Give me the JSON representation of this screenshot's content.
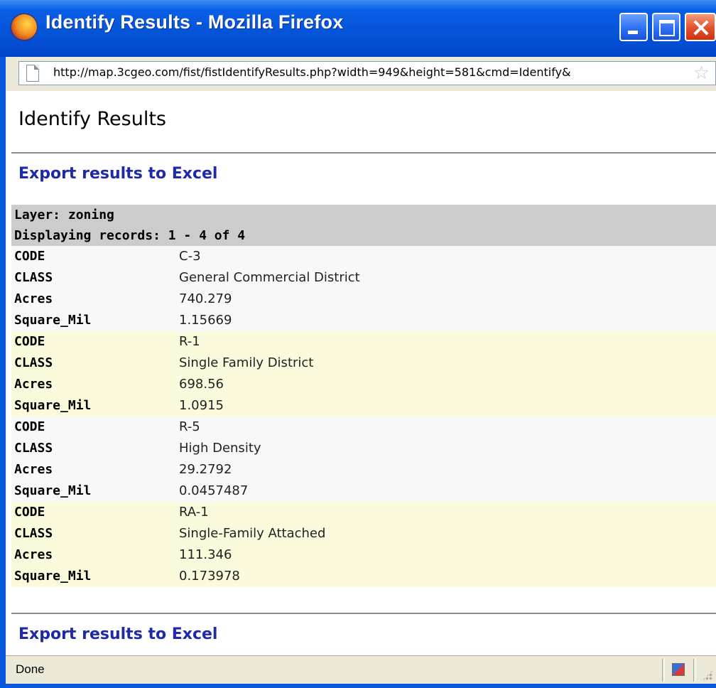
{
  "window": {
    "title": "Identify Results - Mozilla Firefox",
    "url": "http://map.3cgeo.com/fist/fistIdentifyResults.php?width=949&height=581&cmd=Identify&"
  },
  "page": {
    "title": "Identify Results",
    "export_link_label": "Export results to Excel",
    "layer_label": "Layer: zoning",
    "records_label": "Displaying records: 1 - 4 of 4"
  },
  "records": [
    {
      "fields": [
        {
          "key": "CODE",
          "value": "C-3"
        },
        {
          "key": "CLASS",
          "value": "General Commercial District"
        },
        {
          "key": "Acres",
          "value": "740.279"
        },
        {
          "key": "Square_Mil",
          "value": "1.15669"
        }
      ]
    },
    {
      "fields": [
        {
          "key": "CODE",
          "value": "R-1"
        },
        {
          "key": "CLASS",
          "value": "Single Family District"
        },
        {
          "key": "Acres",
          "value": "698.56"
        },
        {
          "key": "Square_Mil",
          "value": "1.0915"
        }
      ]
    },
    {
      "fields": [
        {
          "key": "CODE",
          "value": "R-5"
        },
        {
          "key": "CLASS",
          "value": "High Density"
        },
        {
          "key": "Acres",
          "value": "29.2792"
        },
        {
          "key": "Square_Mil",
          "value": "0.0457487"
        }
      ]
    },
    {
      "fields": [
        {
          "key": "CODE",
          "value": "RA-1"
        },
        {
          "key": "CLASS",
          "value": "Single-Family Attached"
        },
        {
          "key": "Acres",
          "value": "111.346"
        },
        {
          "key": "Square_Mil",
          "value": "0.173978"
        }
      ]
    }
  ],
  "statusbar": {
    "status_text": "Done"
  },
  "icons": {
    "app": "firefox-icon",
    "minimize": "minimize-icon",
    "maximize": "maximize-icon",
    "close": "close-icon",
    "page": "page-icon",
    "bookmark": "star-icon",
    "addon": "addon-icon",
    "resize": "resize-grip-icon"
  }
}
